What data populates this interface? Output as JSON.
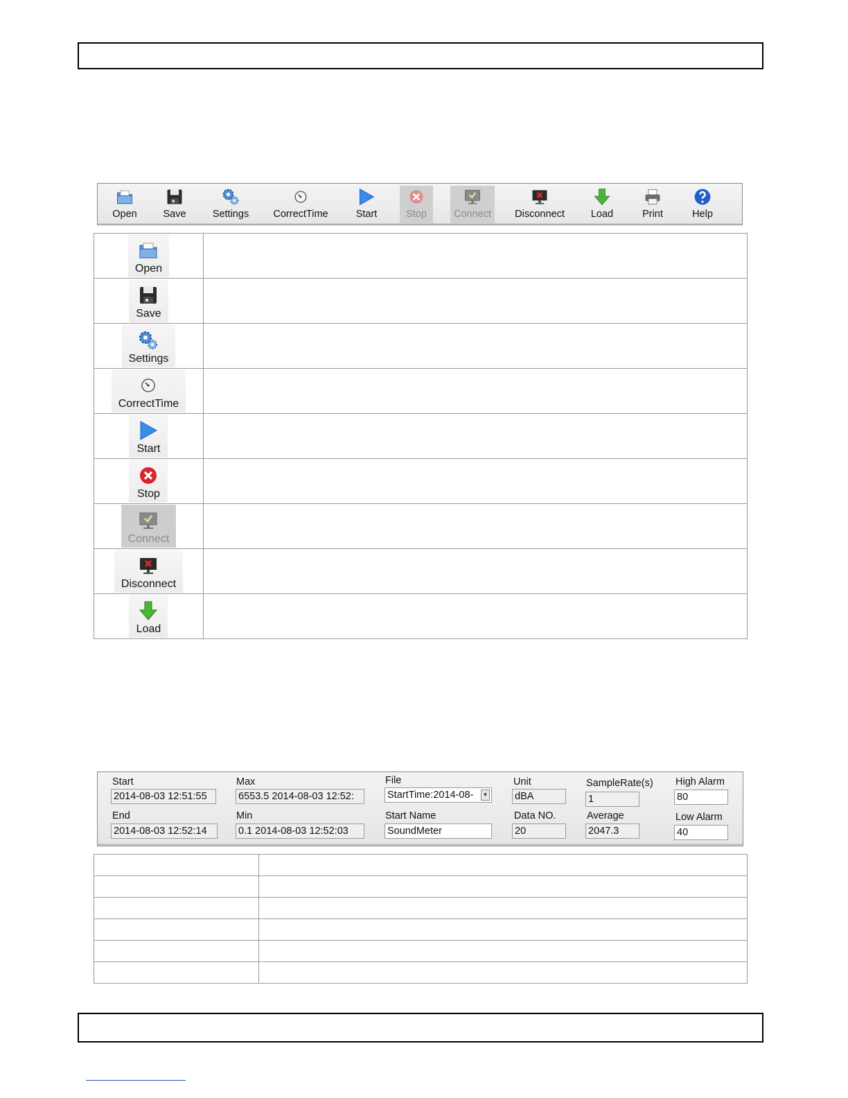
{
  "toolbar": {
    "buttons": [
      {
        "label": "Open",
        "icon": "folder-icon",
        "enabled": true
      },
      {
        "label": "Save",
        "icon": "floppy-disk-icon",
        "enabled": true
      },
      {
        "label": "Settings",
        "icon": "gears-icon",
        "enabled": true
      },
      {
        "label": "CorrectTime",
        "icon": "clock-icon",
        "enabled": true
      },
      {
        "label": "Start",
        "icon": "play-triangle-icon",
        "enabled": true
      },
      {
        "label": "Stop",
        "icon": "stop-x-icon",
        "enabled": false
      },
      {
        "label": "Connect",
        "icon": "monitor-check-icon",
        "enabled": false
      },
      {
        "label": "Disconnect",
        "icon": "monitor-x-icon",
        "enabled": true
      },
      {
        "label": "Load",
        "icon": "down-arrow-icon",
        "enabled": true
      },
      {
        "label": "Print",
        "icon": "printer-icon",
        "enabled": true
      },
      {
        "label": "Help",
        "icon": "help-question-icon",
        "enabled": true
      }
    ]
  },
  "icon_table": {
    "rows": [
      {
        "label": "Open",
        "icon": "folder-icon",
        "enabled": true
      },
      {
        "label": "Save",
        "icon": "floppy-disk-icon",
        "enabled": true
      },
      {
        "label": "Settings",
        "icon": "gears-icon",
        "enabled": true
      },
      {
        "label": "CorrectTime",
        "icon": "clock-icon",
        "enabled": true
      },
      {
        "label": "Start",
        "icon": "play-triangle-icon",
        "enabled": true
      },
      {
        "label": "Stop",
        "icon": "stop-x-icon",
        "enabled": true
      },
      {
        "label": "Connect",
        "icon": "monitor-check-icon",
        "enabled": false
      },
      {
        "label": "Disconnect",
        "icon": "monitor-x-icon",
        "enabled": true
      },
      {
        "label": "Load",
        "icon": "down-arrow-icon",
        "enabled": true
      }
    ]
  },
  "info_panel": {
    "start": {
      "label": "Start",
      "value": "2014-08-03 12:51:55"
    },
    "end": {
      "label": "End",
      "value": "2014-08-03  12:52:14"
    },
    "max": {
      "label": "Max",
      "value": "6553.5 2014-08-03  12:52:"
    },
    "min": {
      "label": "Min",
      "value": "0.1 2014-08-03  12:52:03"
    },
    "file": {
      "label": "File",
      "value": "StartTime:2014-08-"
    },
    "start_name": {
      "label": "Start Name",
      "value": "SoundMeter"
    },
    "unit": {
      "label": "Unit",
      "value": "dBA"
    },
    "data_no": {
      "label": "Data NO.",
      "value": "20"
    },
    "sample_rate": {
      "label": "SampleRate(s)",
      "value": "1"
    },
    "average": {
      "label": "Average",
      "value": "2047.3"
    },
    "high_alarm": {
      "label": "High Alarm",
      "value": "80"
    },
    "low_alarm": {
      "label": "Low Alarm",
      "value": "40"
    }
  },
  "colors": {
    "accent_blue": "#2f7de1",
    "stop_red": "#d8262b",
    "load_green": "#3fae2a",
    "disabled_gray": "#cfcfcf"
  }
}
